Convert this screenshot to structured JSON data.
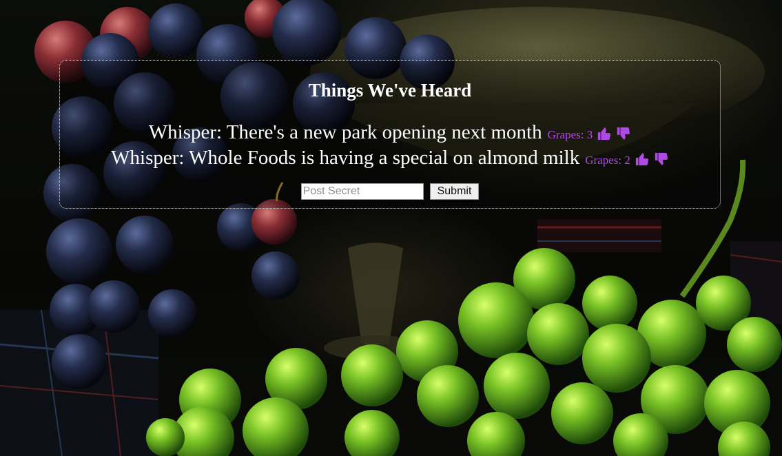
{
  "panel": {
    "title": "Things We've Heard"
  },
  "whispers": [
    {
      "text": "Whisper: There's a new park opening next month",
      "grapes_label": "Grapes: 3",
      "upvote_icon": "thumbs-up-icon",
      "downvote_icon": "thumbs-down-icon"
    },
    {
      "text": "Whisper: Whole Foods is having a special on almond milk",
      "grapes_label": "Grapes: 2",
      "upvote_icon": "thumbs-up-icon",
      "downvote_icon": "thumbs-down-icon"
    }
  ],
  "form": {
    "placeholder": "Post Secret",
    "value": "",
    "submit_label": "Submit"
  },
  "colors": {
    "text": "#ffffff",
    "grapes_accent": "#b04ae6",
    "panel_border": "#d9d9d9"
  }
}
